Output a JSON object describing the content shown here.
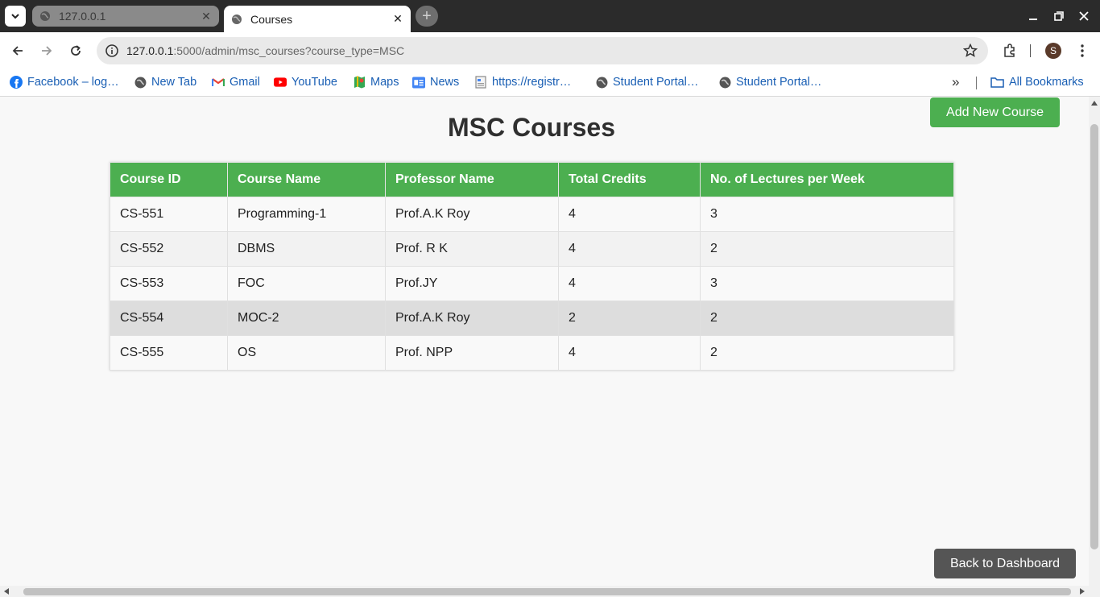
{
  "browser": {
    "tabs": [
      {
        "title": "127.0.0.1",
        "active": false
      },
      {
        "title": "Courses",
        "active": true
      }
    ],
    "address": {
      "host": "127.0.0.1",
      "rest": ":5000/admin/msc_courses?course_type=MSC"
    },
    "profile_initial": "S",
    "bookmarks": [
      {
        "label": "Facebook – log…",
        "icon": "facebook-icon"
      },
      {
        "label": "New Tab",
        "icon": "globe-icon"
      },
      {
        "label": "Gmail",
        "icon": "gmail-icon"
      },
      {
        "label": "YouTube",
        "icon": "youtube-icon"
      },
      {
        "label": "Maps",
        "icon": "maps-icon"
      },
      {
        "label": "News",
        "icon": "news-icon"
      },
      {
        "label": "https://registr…",
        "icon": "document-icon"
      },
      {
        "label": "Student Portal…",
        "icon": "globe-icon"
      },
      {
        "label": "Student Portal…",
        "icon": "globe-icon"
      }
    ],
    "more_bookmarks": "»",
    "all_bookmarks": "All Bookmarks"
  },
  "page": {
    "title": "MSC Courses",
    "add_button": "Add New Course",
    "back_button": "Back to Dashboard"
  },
  "table": {
    "headers": [
      "Course ID",
      "Course Name",
      "Professor Name",
      "Total Credits",
      "No. of Lectures per Week"
    ],
    "rows": [
      [
        "CS-551",
        "Programming-1",
        "Prof.A.K Roy",
        "4",
        "3"
      ],
      [
        "CS-552",
        "DBMS",
        "Prof. R K",
        "4",
        "2"
      ],
      [
        "CS-553",
        "FOC",
        "Prof.JY",
        "4",
        "3"
      ],
      [
        "CS-554",
        "MOC-2",
        "Prof.A.K Roy",
        "2",
        "2"
      ],
      [
        "CS-555",
        "OS",
        "Prof. NPP",
        "4",
        "2"
      ]
    ]
  },
  "colors": {
    "accent": "#4caf50",
    "back_button": "#555555",
    "hover_row": "#dddddd"
  }
}
